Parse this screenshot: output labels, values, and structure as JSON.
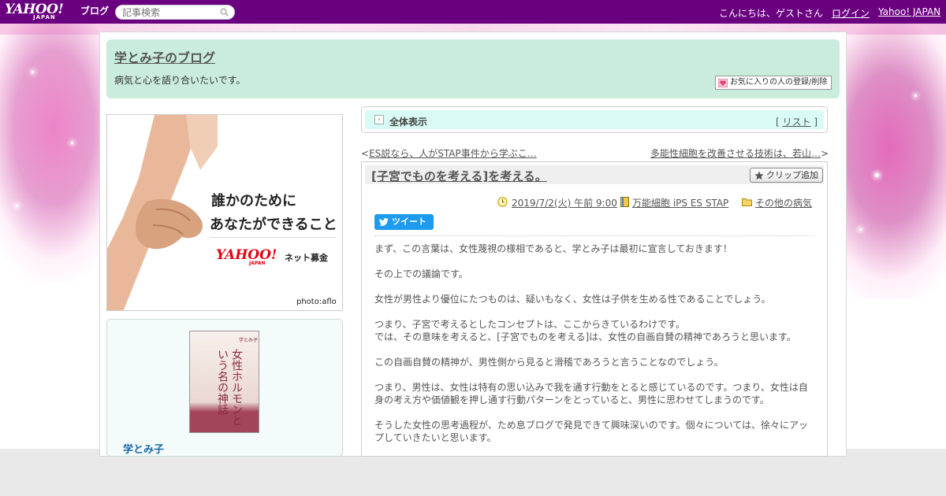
{
  "header": {
    "logo_text": "YAHOO!",
    "logo_sub": "JAPAN",
    "logo_service": "ブログ",
    "search_placeholder": "記事検索",
    "greeting": "こんにちは、ゲストさん",
    "login_label": "ログイン",
    "yahoo_japan_label": "Yahoo! JAPAN"
  },
  "blog": {
    "title": "学とみ子のブログ",
    "description": "病気と心を語り合いたいです。",
    "favorite_button_label": "お気に入りの人の登録/削除"
  },
  "ad": {
    "line1": "誰かのために",
    "line2": "あなたができること",
    "brand": "YAHOO!",
    "brand_sub": "JAPAN",
    "service": "ネット募金",
    "credit": "photo:aflo"
  },
  "profile": {
    "book_title": "女性ホルモンという名の神話",
    "book_author": "学とみ子",
    "name": "学とみ子"
  },
  "nav": {
    "all_label": "全体表示",
    "list_prefix": "[",
    "list_label": "リスト",
    "list_suffix": "]",
    "prev_symbol": "<",
    "prev_label": "ES説なら、人がSTAP事件から学ぶこ…",
    "next_label": "多能性細胞を改善させる技術は、若山…",
    "next_symbol": ">"
  },
  "article": {
    "title": "[子宮でものを考える]を考える。",
    "clip_label": "クリップ追加",
    "date": "2019/7/2(火) 午前 9:00",
    "category": "万能細胞 iPS ES STAP",
    "tag": "その他の病気",
    "tweet_label": "ツイート",
    "paragraphs": [
      "まず、この言葉は、女性蔑視の様相であると、学とみ子は最初に宣言しておきます！",
      "その上での議論です。",
      "女性が男性より優位にたつものは、疑いもなく、女性は子供を生める性であることでしょう。",
      "つまり、子宮で考えるとしたコンセプトは、ここからきているわけです。\nでは、その意味を考えると、[子宮でものを考える]は、女性の自画自賛の精神であろうと思います。",
      "この自画自賛の精神が、男性側から見ると滑稽であろうと言うことなのでしょう。",
      "つまり、男性は、女性は特有の思い込みで我を通す行動をとると感じているのです。つまり、女性は自身の考え方や価値観を押し通す行動パターンをとっていると、男性に思わせてしまうのです。",
      "そうした女性の思考過程が、ため息ブログで発見できて興味深いのです。個々については、徐々にアップしていきたいと思います。"
    ]
  },
  "colors": {
    "topbar": "#6a0080",
    "header_panel": "#c9ecdc",
    "nav_panel": "#d8fcf5",
    "tweet": "#1d9bf0"
  }
}
